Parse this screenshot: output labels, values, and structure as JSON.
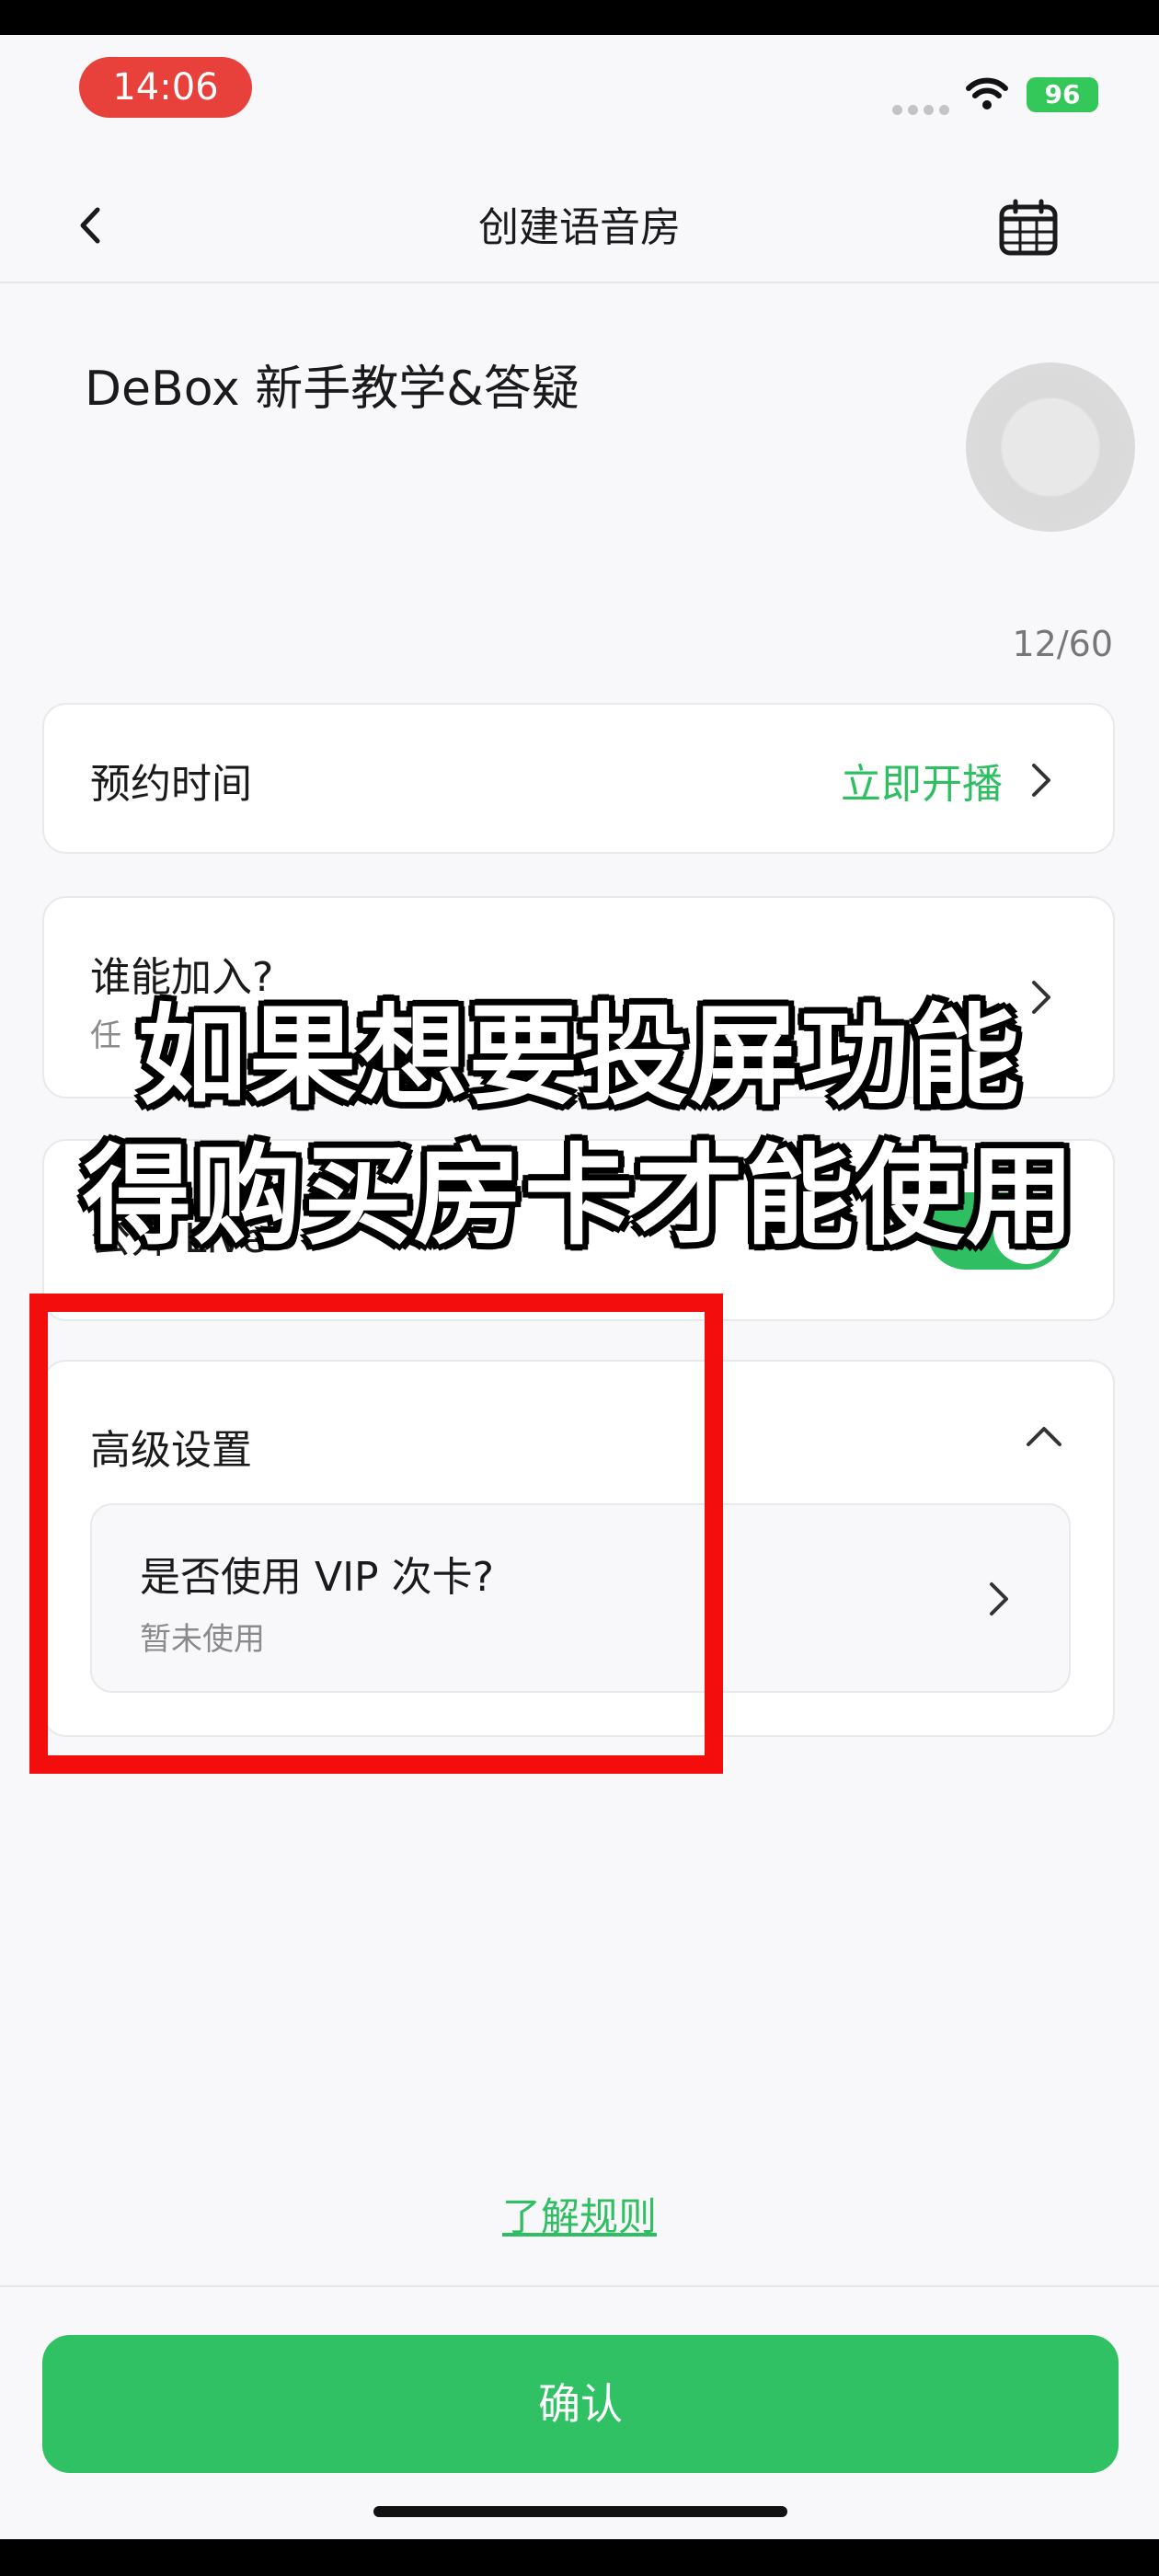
{
  "status_bar": {
    "time": "14:06",
    "battery": "96"
  },
  "nav": {
    "title": "创建语音房"
  },
  "room": {
    "name": "DeBox 新手教学&答疑",
    "char_count": "12/60"
  },
  "schedule": {
    "label": "预约时间",
    "value": "立即开播"
  },
  "join": {
    "label": "谁能加入?",
    "sub": "任"
  },
  "live": {
    "label": "公开 Live",
    "enabled": true
  },
  "advanced": {
    "label": "高级设置",
    "vip": {
      "label": "是否使用 VIP 次卡?",
      "sub": "暂未使用"
    }
  },
  "overlay": {
    "line1": "如果想要投屏功能",
    "line2": "得购买房卡才能使用"
  },
  "rules_link": "了解规则",
  "confirm_button": "确认",
  "colors": {
    "accent": "#2fbf62",
    "highlight": "#f40d0d",
    "time_pill": "#e8403a"
  }
}
